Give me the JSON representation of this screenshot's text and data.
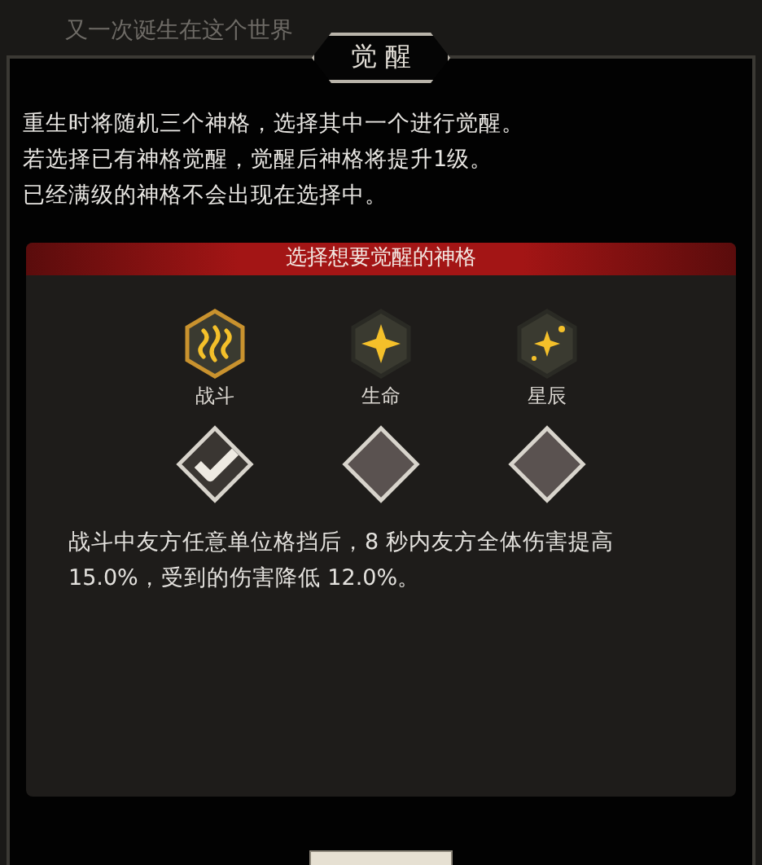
{
  "background_text": "又一次诞生在这个世界",
  "dialog": {
    "title": "觉 醒",
    "intro_lines": [
      "重生时将随机三个神格，选择其中一个进行觉醒。",
      "若选择已有神格觉醒，觉醒后神格将提升1级。",
      "已经满级的神格不会出现在选择中。"
    ],
    "section_title": "选择想要觉醒的神格",
    "choices": [
      {
        "label": "战斗",
        "selected": true
      },
      {
        "label": "生命",
        "selected": false
      },
      {
        "label": "星辰",
        "selected": false
      }
    ],
    "description": "战斗中友方任意单位格挡后，8 秒内友方全体伤害提高 15.0%，受到的伤害降低 12.0%。"
  }
}
